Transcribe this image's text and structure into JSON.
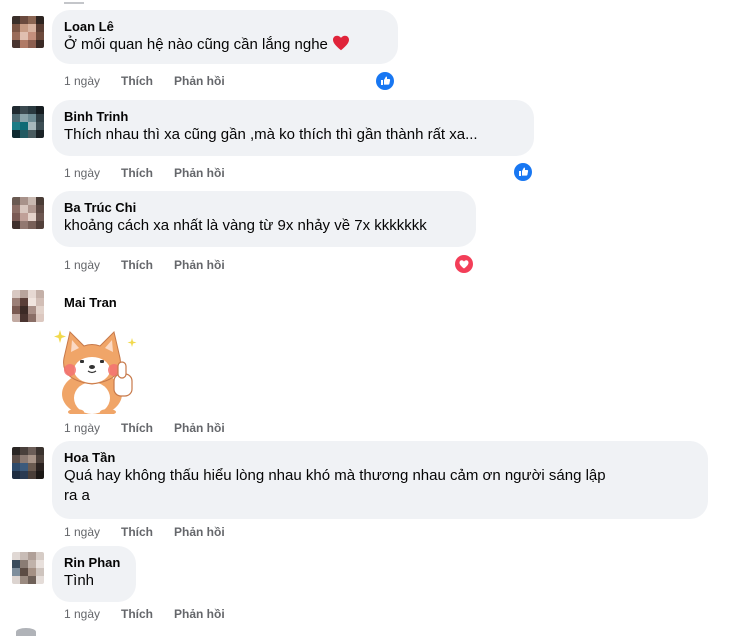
{
  "comments": [
    {
      "author": "Loan Lê",
      "text": "Ở mối quan hệ nào cũng cần lắng nghe",
      "has_heart_emoji": true,
      "time": "1 ngày",
      "like_label": "Thích",
      "reply_label": "Phản hồi",
      "reaction_icon": "like-icon"
    },
    {
      "author": "Binh Trinh",
      "text": "Thích nhau thì xa cũng gần ,mà ko thích thì gần thành rất xa...",
      "time": "1 ngày",
      "like_label": "Thích",
      "reply_label": "Phản hồi",
      "reaction_icon": "like-icon"
    },
    {
      "author": "Ba Trúc Chi",
      "text": "khoảng cách xa nhất là vàng từ 9x nhảy về 7x kkkkkkk",
      "time": "1 ngày",
      "like_label": "Thích",
      "reply_label": "Phản hồi",
      "reaction_icon": "love-icon"
    },
    {
      "author": "Mai Tran",
      "sticker": "shiba-dog-thumbs-up-sticker",
      "time": "1 ngày",
      "like_label": "Thích",
      "reply_label": "Phản hồi"
    },
    {
      "author": "Hoa Tần",
      "text_line1": "Quá hay không thấu hiểu lòng nhau khó mà thương nhau cảm ơn người sáng lập",
      "text_line2": "ra a",
      "time": "1 ngày",
      "like_label": "Thích",
      "reply_label": "Phản hồi"
    },
    {
      "author": "Rin Phan",
      "text": "Tình",
      "time": "1 ngày",
      "like_label": "Thích",
      "reply_label": "Phản hồi"
    }
  ],
  "colors": {
    "bubble_bg": "#f0f2f5",
    "meta_text": "#65676b",
    "like_blue": "#1877f2",
    "love_red": "#f33e58"
  }
}
